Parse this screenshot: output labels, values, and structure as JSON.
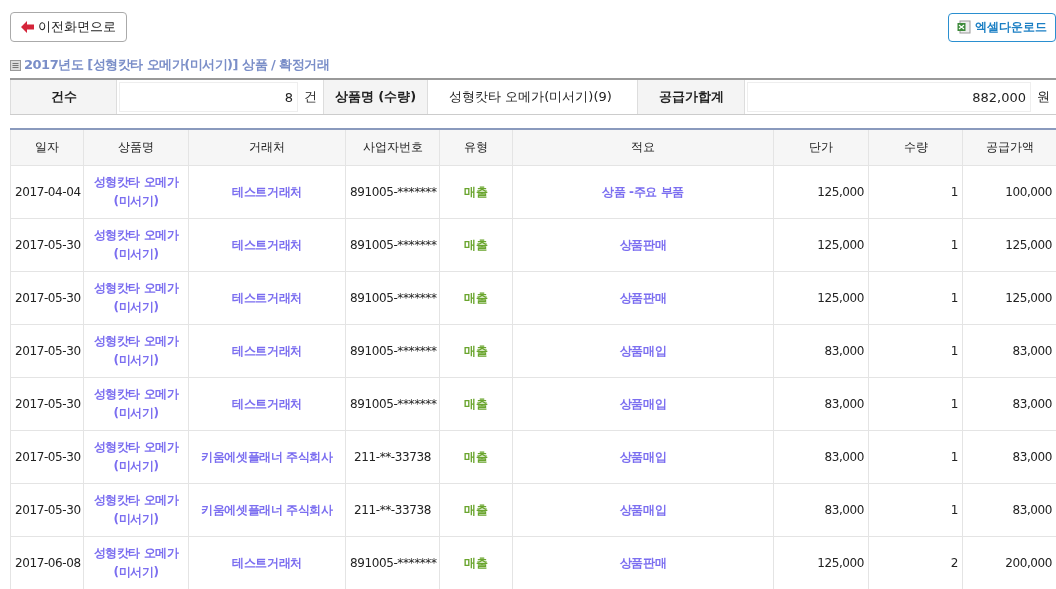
{
  "back_button": "이전화면으로",
  "excel_button": "엑셀다운로드",
  "title": "2017년도 [성형캇타 오메가(미서기)] 상품 / 확정거래",
  "summary": {
    "count_label": "건수",
    "count": "8",
    "count_unit": "건",
    "product_label": "상품명 (수량)",
    "product": "성형캇타 오메가(미서기)(9)",
    "total_label": "공급가합계",
    "total": "882,000",
    "total_unit": "원"
  },
  "table": {
    "columns": [
      "일자",
      "상품명",
      "거래처",
      "사업자번호",
      "유형",
      "적요",
      "단가",
      "수량",
      "공급가액"
    ],
    "rows": [
      [
        "2017-04-04",
        "성형캇타 오메가(미서기)",
        "테스트거래처",
        "891005-*******",
        "매출",
        "상품 -주요 부품",
        "125,000",
        "1",
        "100,000"
      ],
      [
        "2017-05-30",
        "성형캇타 오메가(미서기)",
        "테스트거래처",
        "891005-*******",
        "매출",
        "상품판매",
        "125,000",
        "1",
        "125,000"
      ],
      [
        "2017-05-30",
        "성형캇타 오메가(미서기)",
        "테스트거래처",
        "891005-*******",
        "매출",
        "상품판매",
        "125,000",
        "1",
        "125,000"
      ],
      [
        "2017-05-30",
        "성형캇타 오메가(미서기)",
        "테스트거래처",
        "891005-*******",
        "매출",
        "상품매입",
        "83,000",
        "1",
        "83,000"
      ],
      [
        "2017-05-30",
        "성형캇타 오메가(미서기)",
        "테스트거래처",
        "891005-*******",
        "매출",
        "상품매입",
        "83,000",
        "1",
        "83,000"
      ],
      [
        "2017-05-30",
        "성형캇타 오메가(미서기)",
        "키움에셋플래너 주식회사",
        "211-**-33738",
        "매출",
        "상품매입",
        "83,000",
        "1",
        "83,000"
      ],
      [
        "2017-05-30",
        "성형캇타 오메가(미서기)",
        "키움에셋플래너 주식회사",
        "211-**-33738",
        "매출",
        "상품매입",
        "83,000",
        "1",
        "83,000"
      ],
      [
        "2017-06-08",
        "성형캇타 오메가(미서기)",
        "테스트거래처",
        "891005-*******",
        "매출",
        "상품판매",
        "125,000",
        "2",
        "200,000"
      ]
    ]
  }
}
